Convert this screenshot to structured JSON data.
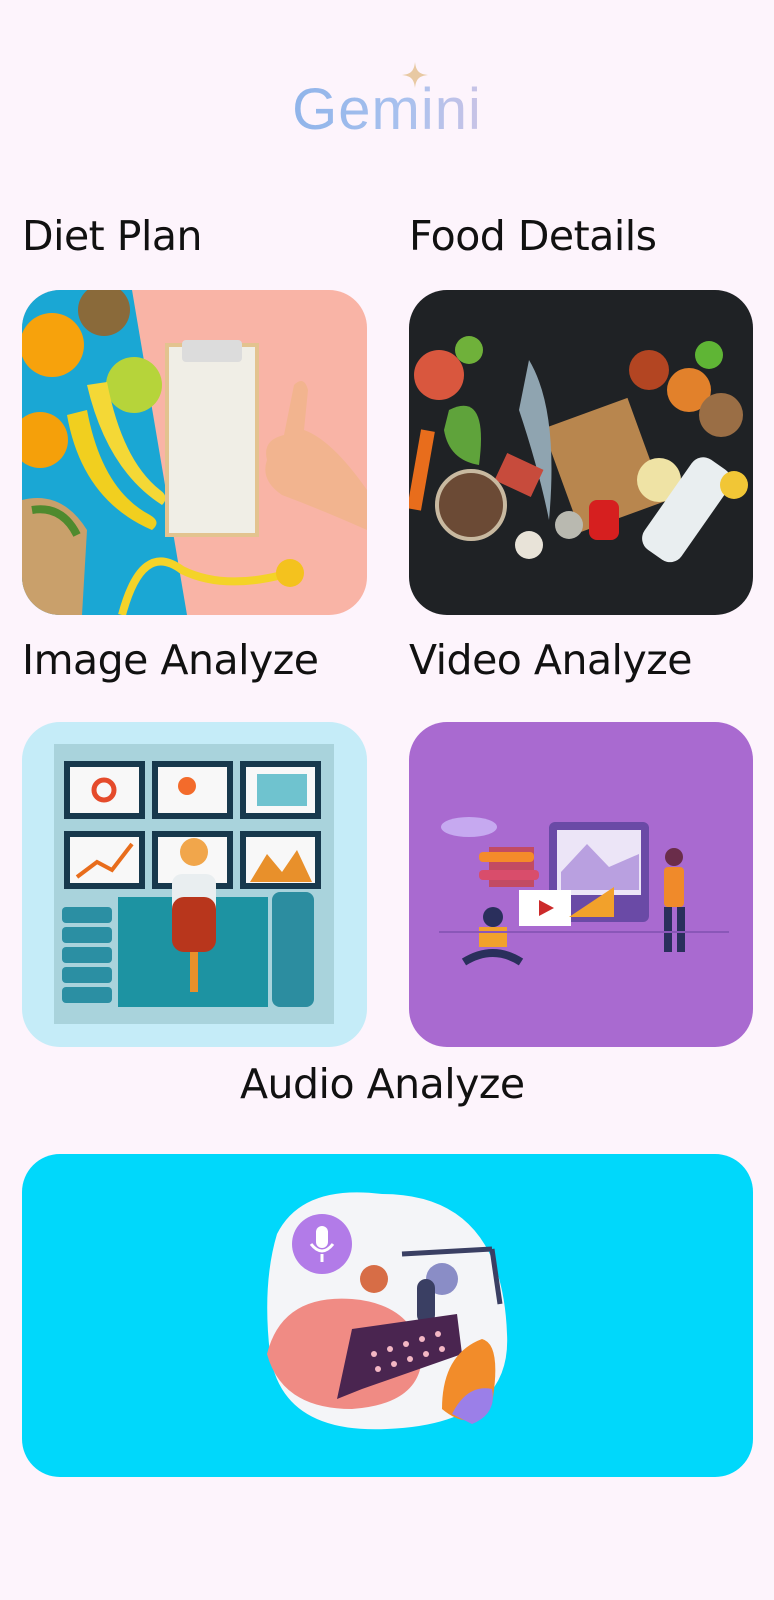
{
  "app": {
    "logo_text": "Gemini"
  },
  "cards": [
    {
      "label": "Diet Plan"
    },
    {
      "label": "Food Details"
    },
    {
      "label": "Image Analyze"
    },
    {
      "label": "Video Analyze"
    },
    {
      "label": "Audio Analyze"
    }
  ],
  "colors": {
    "background": "#fdf4fc",
    "video_card": "#a96ad0",
    "audio_card": "#00d8fb",
    "image_card": "#c5ecf8"
  }
}
